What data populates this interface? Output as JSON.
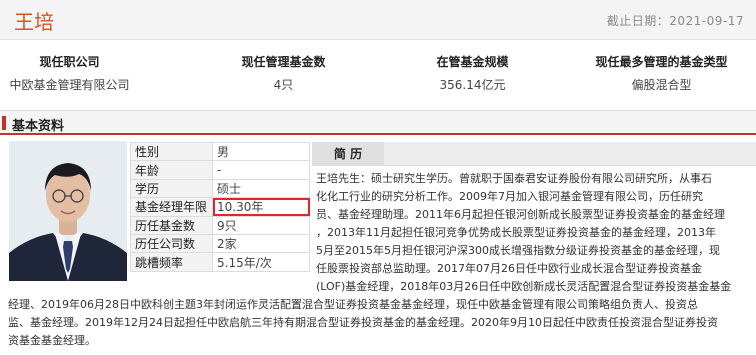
{
  "header": {
    "name": "王培",
    "date_label": "截止日期：2021-09-17"
  },
  "stats": [
    {
      "label": "现任职公司",
      "value": "中欧基金管理有限公司"
    },
    {
      "label": "现任管理基金数",
      "value": "4只"
    },
    {
      "label": "在管基金规模",
      "value": "356.14亿元"
    },
    {
      "label": "现任最多管理的基金类型",
      "value": "偏股混合型"
    }
  ],
  "section_title": "基本资料",
  "info": [
    {
      "k": "性别",
      "v": "男"
    },
    {
      "k": "年龄",
      "v": "-"
    },
    {
      "k": "学历",
      "v": "硕士"
    },
    {
      "k": "基金经理年限",
      "v": "10.30年"
    },
    {
      "k": "历任基金数",
      "v": "9只"
    },
    {
      "k": "历任公司数",
      "v": "2家"
    },
    {
      "k": "跳槽频率",
      "v": "5.15年/次"
    }
  ],
  "bio": {
    "title": "简 历",
    "lines": [
      "王培先生：硕士研究生学历。曾就职于国泰君安证券股份有限公司研究所，从事石",
      "化化工行业的研究分析工作。2009年7月加入银河基金管理有限公司，历任研究",
      "员、基金经理助理。2011年6月起担任银河创新成长股票型证券投资基金的基金经理",
      "，2013年11月起担任银河竞争优势成长股票型证券投资基金的基金经理，2013年",
      "5月至2015年5月担任银河沪深300成长增强指数分级证券投资基金的基金经理，现",
      "任股票投资部总监助理。2017年07月26日任中欧行业成长混合型证券投资基金",
      "(LOF)基金经理，2018年03月26日任中欧创新成长灵活配置混合型证券投资基金基金",
      "经理、2019年06月28日中欧科创主题3年封闭运作灵活配置混合型证券投资基金基金经理，现任中欧基金管理有限公司策略组负责人、投资总",
      "监、基金经理。2019年12月24日起担任中欧启航三年持有期混合型证券投资基金的基金经理。2020年9月10日起任中欧责任投资混合型证券投资",
      "资基金基金经理。"
    ]
  }
}
